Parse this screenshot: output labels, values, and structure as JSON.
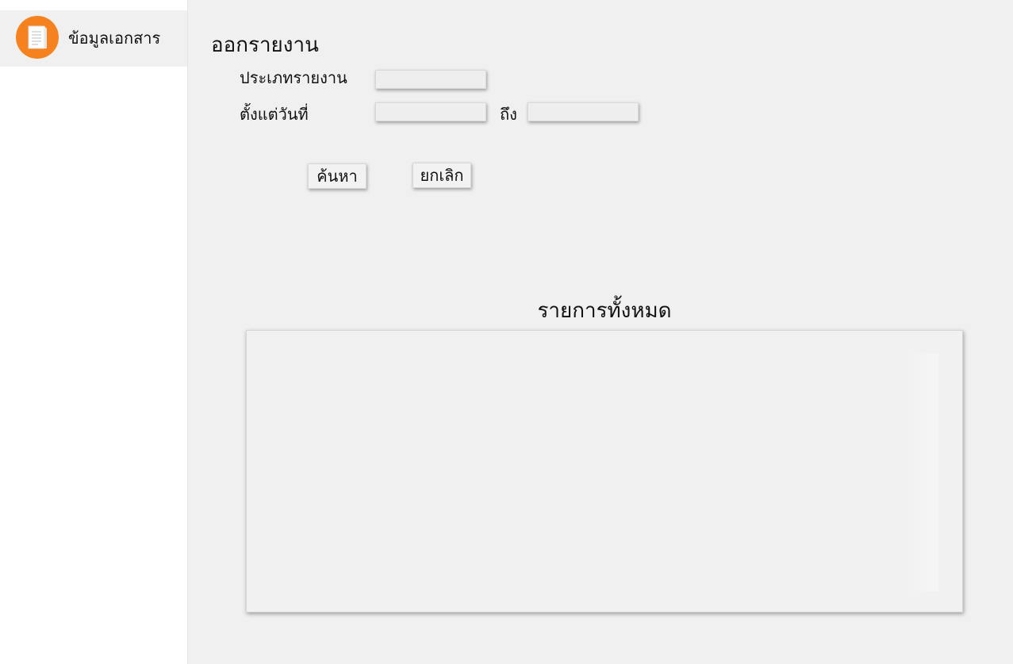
{
  "sidebar": {
    "items": [
      {
        "label": "ข้อมูลเอกสาร",
        "icon": "document-icon"
      }
    ]
  },
  "main": {
    "title": "ออกรายงาน",
    "form": {
      "report_type_label": "ประเภทรายงาน",
      "report_type_value": "",
      "from_date_label": "ตั้งแต่วันที่",
      "from_date_value": "",
      "to_date_label": "ถึง",
      "to_date_value": ""
    },
    "buttons": {
      "search_label": "ค้นหา",
      "cancel_label": "ยกเลิก"
    },
    "list": {
      "title": "รายการทั้งหมด",
      "items": []
    }
  },
  "colors": {
    "accent": "#f5821f",
    "background": "#f0f0f0",
    "sidebar_background": "#ffffff"
  }
}
